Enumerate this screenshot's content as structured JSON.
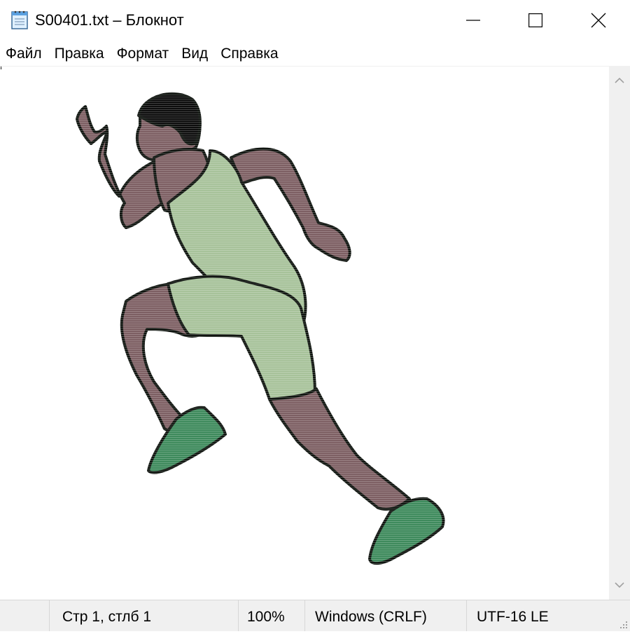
{
  "window": {
    "title": "S00401.txt – Блокнот",
    "app_icon": "notepad-icon",
    "controls": {
      "minimize": "minimize-icon",
      "maximize": "maximize-icon",
      "close": "close-icon"
    }
  },
  "menu": {
    "items": [
      {
        "label": "Файл"
      },
      {
        "label": "Правка"
      },
      {
        "label": "Формат"
      },
      {
        "label": "Вид"
      },
      {
        "label": "Справка"
      }
    ]
  },
  "editor": {
    "content_description_icon": "running-athlete-ascii-art",
    "colors": {
      "skin": "#7d5f63",
      "suit": "#a7c29a",
      "shoes": "#3e8a5c",
      "outline": "#101510"
    }
  },
  "statusbar": {
    "position": "Стр 1, стлб 1",
    "zoom": "100%",
    "line_endings": "Windows (CRLF)",
    "encoding": "UTF-16 LE"
  }
}
